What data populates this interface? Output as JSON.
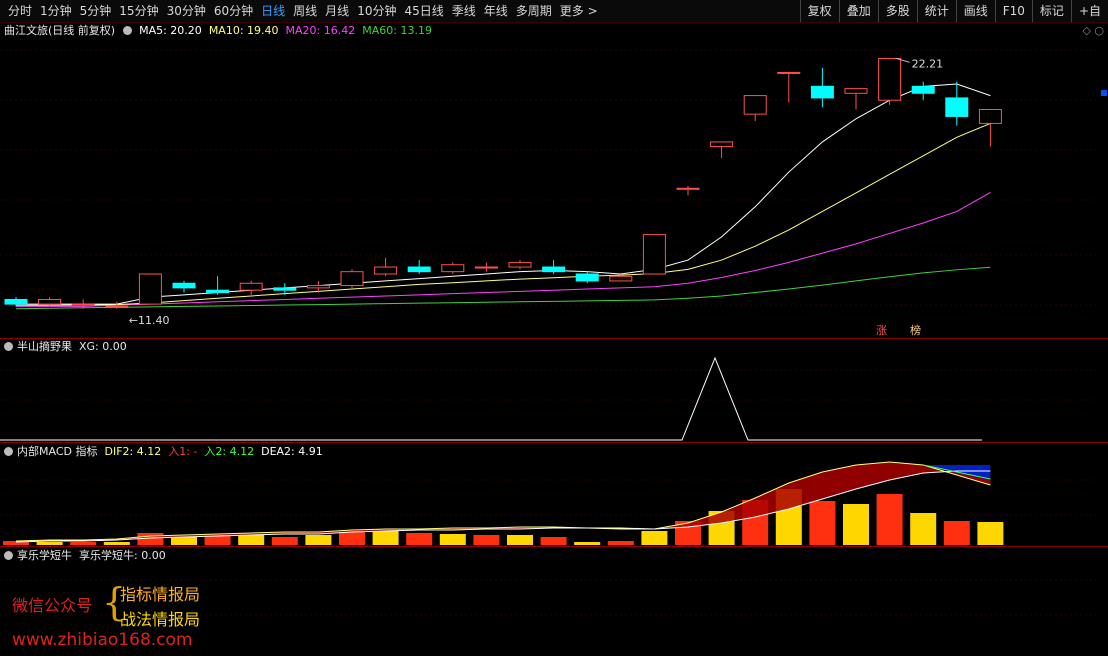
{
  "toolbar": {
    "periods": [
      "分时",
      "1分钟",
      "5分钟",
      "15分钟",
      "30分钟",
      "60分钟",
      "日线",
      "周线",
      "月线",
      "10分钟",
      "45日线",
      "季线",
      "年线",
      "多周期",
      "更多 >"
    ],
    "active_index": 6,
    "right": [
      "复权",
      "叠加",
      "多股",
      "统计",
      "画线",
      "F10",
      "标记",
      "+自"
    ]
  },
  "main_panel": {
    "stock_name": "曲江文旅(日线 前复权)",
    "ma5": "MA5: 20.20",
    "ma10": "MA10: 19.40",
    "ma20": "MA20: 16.42",
    "ma60": "MA60: 13.19",
    "high_label": "22.21",
    "low_label": "11.40",
    "tags": [
      "涨",
      "榜"
    ],
    "colors": {
      "ma5": "#ffffff",
      "ma10": "#ffff80",
      "ma20": "#ff40ff",
      "ma60": "#40d040",
      "up": "#ff5050",
      "down": "#00ffff"
    }
  },
  "panel2": {
    "title": "半山摘野果",
    "value": "XG: 0.00"
  },
  "panel3": {
    "title": "内部MACD 指标",
    "dif": "DIF2: 4.12",
    "in1": "入1: -",
    "in2": "入2: 4.12",
    "dea": "DEA2: 4.91"
  },
  "panel4": {
    "title": "享乐学短牛",
    "value": "享乐学短牛: 0.00"
  },
  "watermark": {
    "wechat": "微信公众号",
    "line1": "指标情报局",
    "line2": "战法情报局",
    "url": "www.zhibiao168.com"
  },
  "chart_data": {
    "type": "candlestick",
    "candles": [
      {
        "o": 11.8,
        "c": 11.6,
        "h": 11.9,
        "l": 11.5
      },
      {
        "o": 11.6,
        "c": 11.8,
        "h": 11.9,
        "l": 11.5
      },
      {
        "o": 11.6,
        "c": 11.6,
        "h": 11.8,
        "l": 11.4
      },
      {
        "o": 11.5,
        "c": 11.5,
        "h": 11.7,
        "l": 11.4
      },
      {
        "o": 11.6,
        "c": 12.9,
        "h": 12.9,
        "l": 11.6
      },
      {
        "o": 12.5,
        "c": 12.3,
        "h": 12.6,
        "l": 12.1
      },
      {
        "o": 12.2,
        "c": 12.1,
        "h": 12.8,
        "l": 12.0
      },
      {
        "o": 12.2,
        "c": 12.5,
        "h": 12.6,
        "l": 12.0
      },
      {
        "o": 12.3,
        "c": 12.2,
        "h": 12.5,
        "l": 12.0
      },
      {
        "o": 12.3,
        "c": 12.4,
        "h": 12.6,
        "l": 12.1
      },
      {
        "o": 12.4,
        "c": 13.0,
        "h": 13.1,
        "l": 12.3
      },
      {
        "o": 12.9,
        "c": 13.2,
        "h": 13.6,
        "l": 12.8
      },
      {
        "o": 13.2,
        "c": 13.0,
        "h": 13.5,
        "l": 12.9
      },
      {
        "o": 13.0,
        "c": 13.3,
        "h": 13.4,
        "l": 12.9
      },
      {
        "o": 13.2,
        "c": 13.2,
        "h": 13.4,
        "l": 13.0
      },
      {
        "o": 13.2,
        "c": 13.4,
        "h": 13.5,
        "l": 13.1
      },
      {
        "o": 13.2,
        "c": 13.0,
        "h": 13.5,
        "l": 12.9
      },
      {
        "o": 12.9,
        "c": 12.6,
        "h": 13.0,
        "l": 12.5
      },
      {
        "o": 12.6,
        "c": 12.8,
        "h": 12.9,
        "l": 12.6
      },
      {
        "o": 12.9,
        "c": 14.6,
        "h": 14.6,
        "l": 12.9
      },
      {
        "o": 16.6,
        "c": 16.6,
        "h": 16.7,
        "l": 16.3
      },
      {
        "o": 18.4,
        "c": 18.6,
        "h": 18.6,
        "l": 17.9
      },
      {
        "o": 19.8,
        "c": 20.6,
        "h": 20.6,
        "l": 19.5
      },
      {
        "o": 21.6,
        "c": 21.6,
        "h": 21.6,
        "l": 20.3
      },
      {
        "o": 21.0,
        "c": 20.5,
        "h": 21.8,
        "l": 20.1
      },
      {
        "o": 20.7,
        "c": 20.9,
        "h": 20.9,
        "l": 20.0
      },
      {
        "o": 20.4,
        "c": 22.2,
        "h": 22.21,
        "l": 20.2
      },
      {
        "o": 21.0,
        "c": 20.7,
        "h": 21.2,
        "l": 20.4
      },
      {
        "o": 20.5,
        "c": 19.7,
        "h": 21.2,
        "l": 19.3
      },
      {
        "o": 19.4,
        "c": 20.0,
        "h": 20.0,
        "l": 18.4
      }
    ],
    "ma5": [
      11.6,
      11.6,
      11.6,
      11.6,
      11.9,
      12.0,
      12.1,
      12.2,
      12.3,
      12.4,
      12.5,
      12.6,
      12.7,
      12.8,
      12.9,
      13.0,
      13.05,
      13.0,
      12.9,
      13.1,
      13.5,
      14.5,
      15.8,
      17.3,
      18.6,
      19.6,
      20.4,
      21.0,
      21.1,
      20.6
    ],
    "ma10": [
      11.55,
      11.55,
      11.56,
      11.58,
      11.65,
      11.75,
      11.85,
      11.95,
      12.05,
      12.15,
      12.25,
      12.35,
      12.45,
      12.52,
      12.6,
      12.68,
      12.74,
      12.8,
      12.85,
      12.92,
      13.1,
      13.5,
      14.1,
      14.8,
      15.6,
      16.4,
      17.2,
      18.0,
      18.8,
      19.4
    ],
    "ma20": [
      11.5,
      11.5,
      11.5,
      11.55,
      11.6,
      11.65,
      11.7,
      11.75,
      11.8,
      11.85,
      11.9,
      11.95,
      12.0,
      12.05,
      12.1,
      12.15,
      12.2,
      12.25,
      12.3,
      12.35,
      12.5,
      12.75,
      13.05,
      13.4,
      13.8,
      14.2,
      14.65,
      15.1,
      15.6,
      16.42
    ],
    "ma60": [
      11.4,
      11.42,
      11.44,
      11.46,
      11.48,
      11.5,
      11.52,
      11.54,
      11.56,
      11.58,
      11.6,
      11.62,
      11.64,
      11.66,
      11.68,
      11.7,
      11.72,
      11.74,
      11.76,
      11.78,
      11.85,
      11.95,
      12.1,
      12.25,
      12.42,
      12.6,
      12.78,
      12.95,
      13.08,
      13.19
    ],
    "ylim": [
      11.0,
      23.0
    ]
  }
}
